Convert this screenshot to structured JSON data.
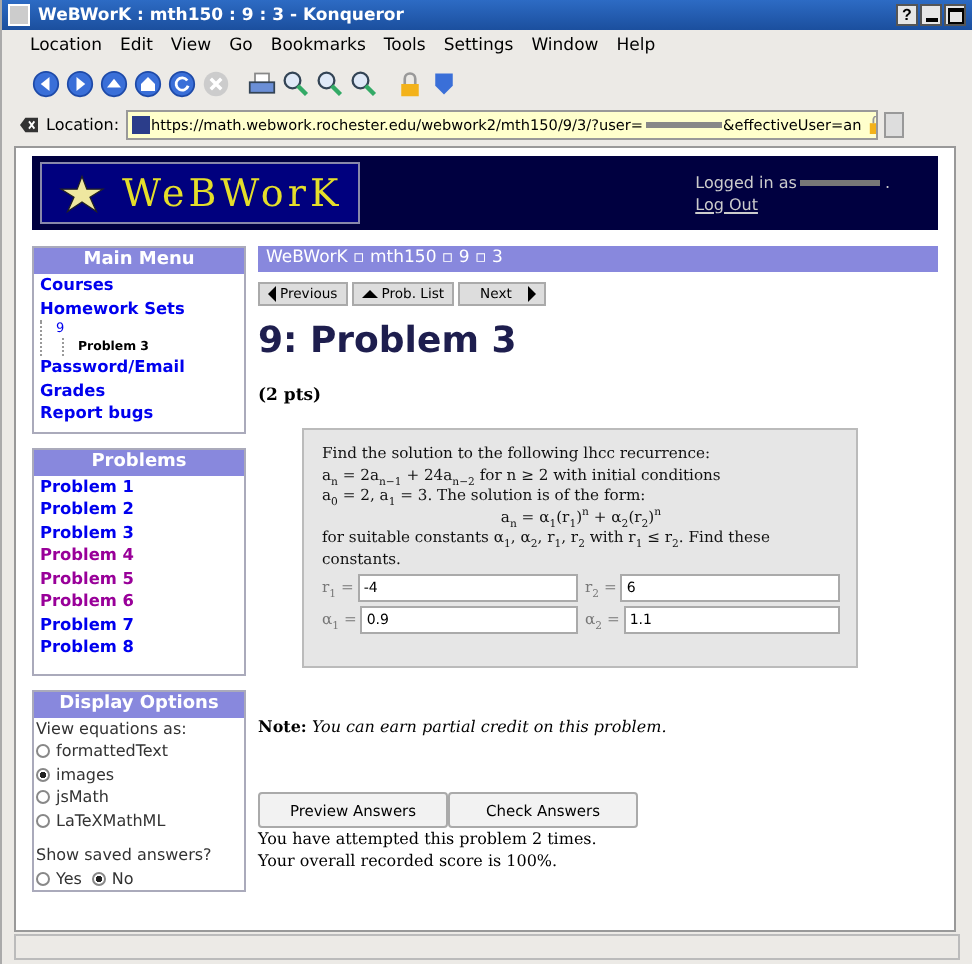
{
  "window": {
    "title": "WeBWorK : mth150 : 9 : 3 - Konqueror",
    "controls": [
      "?"
    ]
  },
  "menu": [
    "Location",
    "Edit",
    "View",
    "Go",
    "Bookmarks",
    "Tools",
    "Settings",
    "Window",
    "Help"
  ],
  "location": {
    "label": "Location:",
    "url_start": "https://math.webwork.rochester.edu/webwork2/mth150/9/3/?user=",
    "url_end": "&effectiveUser=an"
  },
  "header": {
    "logo": "WeBWorK",
    "logged_in": "Logged in as",
    "logged_in_end": ".",
    "logout": "Log Out"
  },
  "main_menu": {
    "title": "Main Menu",
    "items": [
      {
        "label": "Courses"
      },
      {
        "label": "Homework Sets",
        "children": [
          {
            "label": "9",
            "current": false,
            "children": [
              {
                "label": "Problem 3",
                "current": true
              }
            ]
          }
        ]
      },
      {
        "label": "Password/Email"
      },
      {
        "label": "Grades"
      },
      {
        "label": "Report bugs"
      }
    ]
  },
  "problems": {
    "title": "Problems",
    "items": [
      {
        "label": "Problem 1",
        "color": "#0000ee"
      },
      {
        "label": "Problem 2",
        "color": "#0000ee"
      },
      {
        "label": "Problem 3",
        "color": "#0000ee"
      },
      {
        "label": "Problem 4",
        "color": "#990099"
      },
      {
        "label": "Problem 5",
        "color": "#990099"
      },
      {
        "label": "Problem 6",
        "color": "#990099"
      },
      {
        "label": "Problem 7",
        "color": "#0000ee"
      },
      {
        "label": "Problem 8",
        "color": "#0000ee"
      }
    ]
  },
  "display_options": {
    "title": "Display Options",
    "view_label": "View equations as:",
    "view_options": [
      {
        "label": "formattedText",
        "selected": false
      },
      {
        "label": "images",
        "selected": true
      },
      {
        "label": "jsMath",
        "selected": false
      },
      {
        "label": "LaTeXMathML",
        "selected": false
      }
    ],
    "saved_label": "Show saved answers?",
    "saved_options": [
      {
        "label": "Yes",
        "selected": false
      },
      {
        "label": "No",
        "selected": true
      }
    ]
  },
  "breadcrumb": "WeBWorK ▫ mth150 ▫ 9 ▫ 3",
  "nav": [
    {
      "label": "Previous",
      "kind": "prev"
    },
    {
      "label": "Prob. List",
      "kind": "up"
    },
    {
      "label": "Next",
      "kind": "next"
    }
  ],
  "title": "9: Problem 3",
  "points": "(2 pts)",
  "problem_lines": [
    {
      "text": "Find the solution to the following lhcc recurrence:",
      "kind": "left"
    },
    {
      "text": "a$_{n}$ = 2a$_{n−1}$ + 24a$_{n−2}$ for n ≥ 2 with initial conditions",
      "kind": "left"
    },
    {
      "text": "a$_{0}$ = 2, a$_{1}$ = 3. The solution is of the form:",
      "kind": "left"
    },
    {
      "text": "a$_{n}$ = α$_{1}$(r$_{1}$)$^{n}$ + α$_{2}$(r$_{2}$)$^{n}$",
      "kind": "center"
    },
    {
      "text": "for suitable constants α$_{1}$, α$_{2}$, r$_{1}$, r$_{2}$ with r$_{1}$ ≤ r$_{2}$. Find these constants.",
      "kind": "left"
    }
  ],
  "answers": [
    {
      "label": "r$_{1}$ =",
      "value": "-4"
    },
    {
      "label": "r$_{2}$ =",
      "value": "6"
    },
    {
      "label": "α$_{1}$ =",
      "value": "0.9"
    },
    {
      "label": "α$_{2}$ =",
      "value": "1.1"
    }
  ],
  "note": {
    "label": "Note:",
    "text": "You can earn partial credit on this problem."
  },
  "buttons": [
    "Preview Answers",
    "Check Answers"
  ],
  "status": [
    "You have attempted this problem 2 times.",
    "Your overall recorded score is 100%."
  ]
}
